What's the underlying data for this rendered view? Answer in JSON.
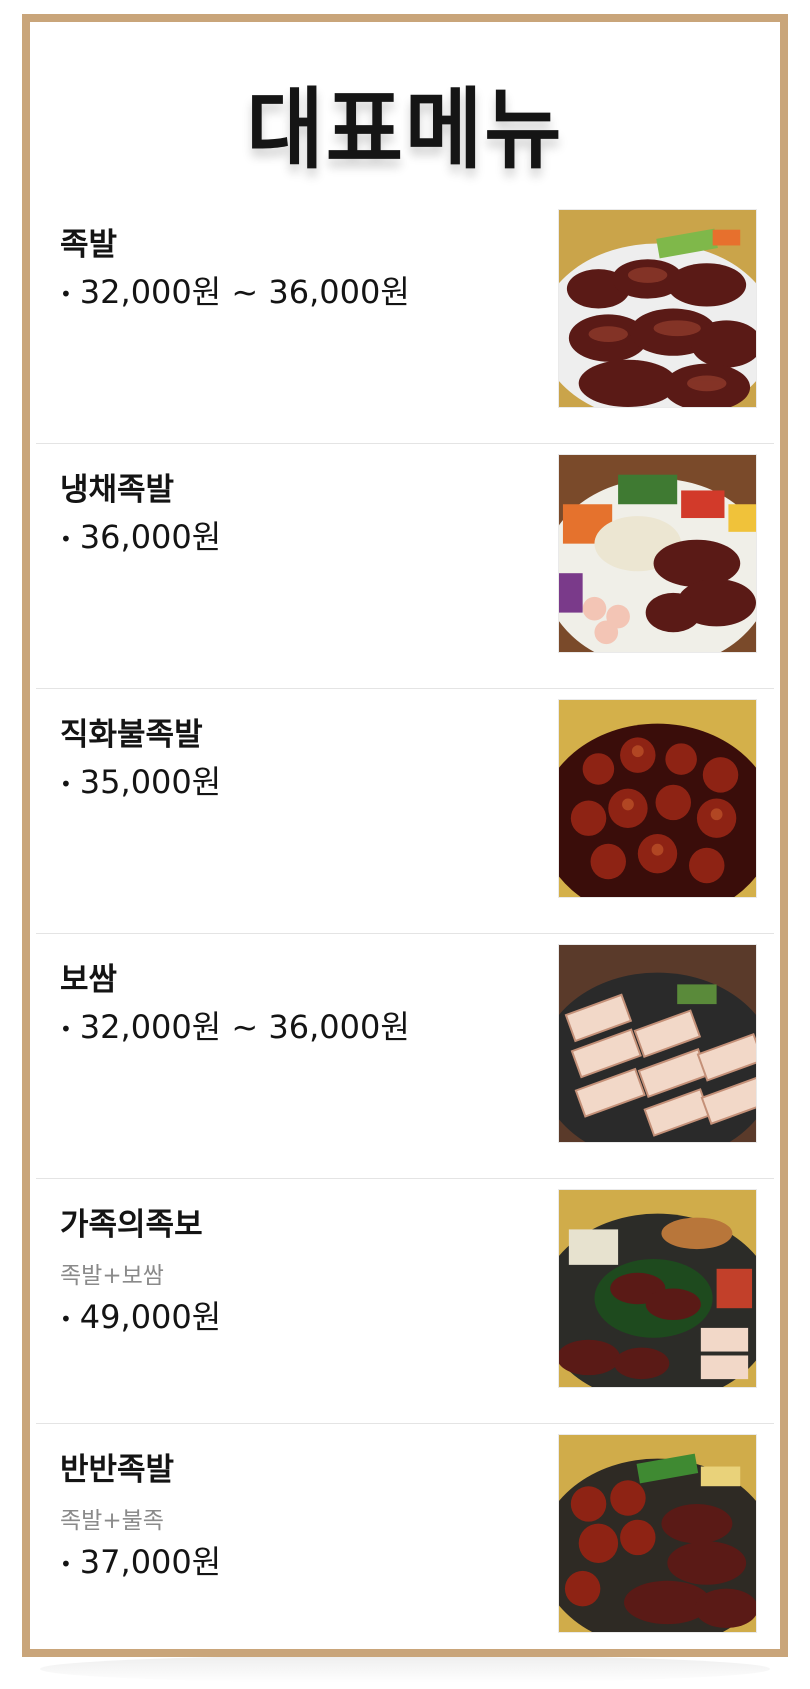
{
  "page": {
    "title": "대표메뉴"
  },
  "menu": [
    {
      "name": "족발",
      "description": "",
      "price": "32,000원 ~ 36,000원",
      "image": "jokbal-photo"
    },
    {
      "name": "냉채족발",
      "description": "",
      "price": "36,000원",
      "image": "cold-jokbal-photo"
    },
    {
      "name": "직화불족발",
      "description": "",
      "price": "35,000원",
      "image": "fire-jokbal-photo"
    },
    {
      "name": "보쌈",
      "description": "",
      "price": "32,000원 ~ 36,000원",
      "image": "bossam-photo"
    },
    {
      "name": "가족의족보",
      "description": "족발+보쌈",
      "price": "49,000원",
      "image": "family-set-photo"
    },
    {
      "name": "반반족발",
      "description": "족발+불족",
      "price": "37,000원",
      "image": "half-half-photo"
    }
  ],
  "colors": {
    "frame": "#c9a57a",
    "text": "#141414",
    "subtext": "#8a8a8a"
  }
}
